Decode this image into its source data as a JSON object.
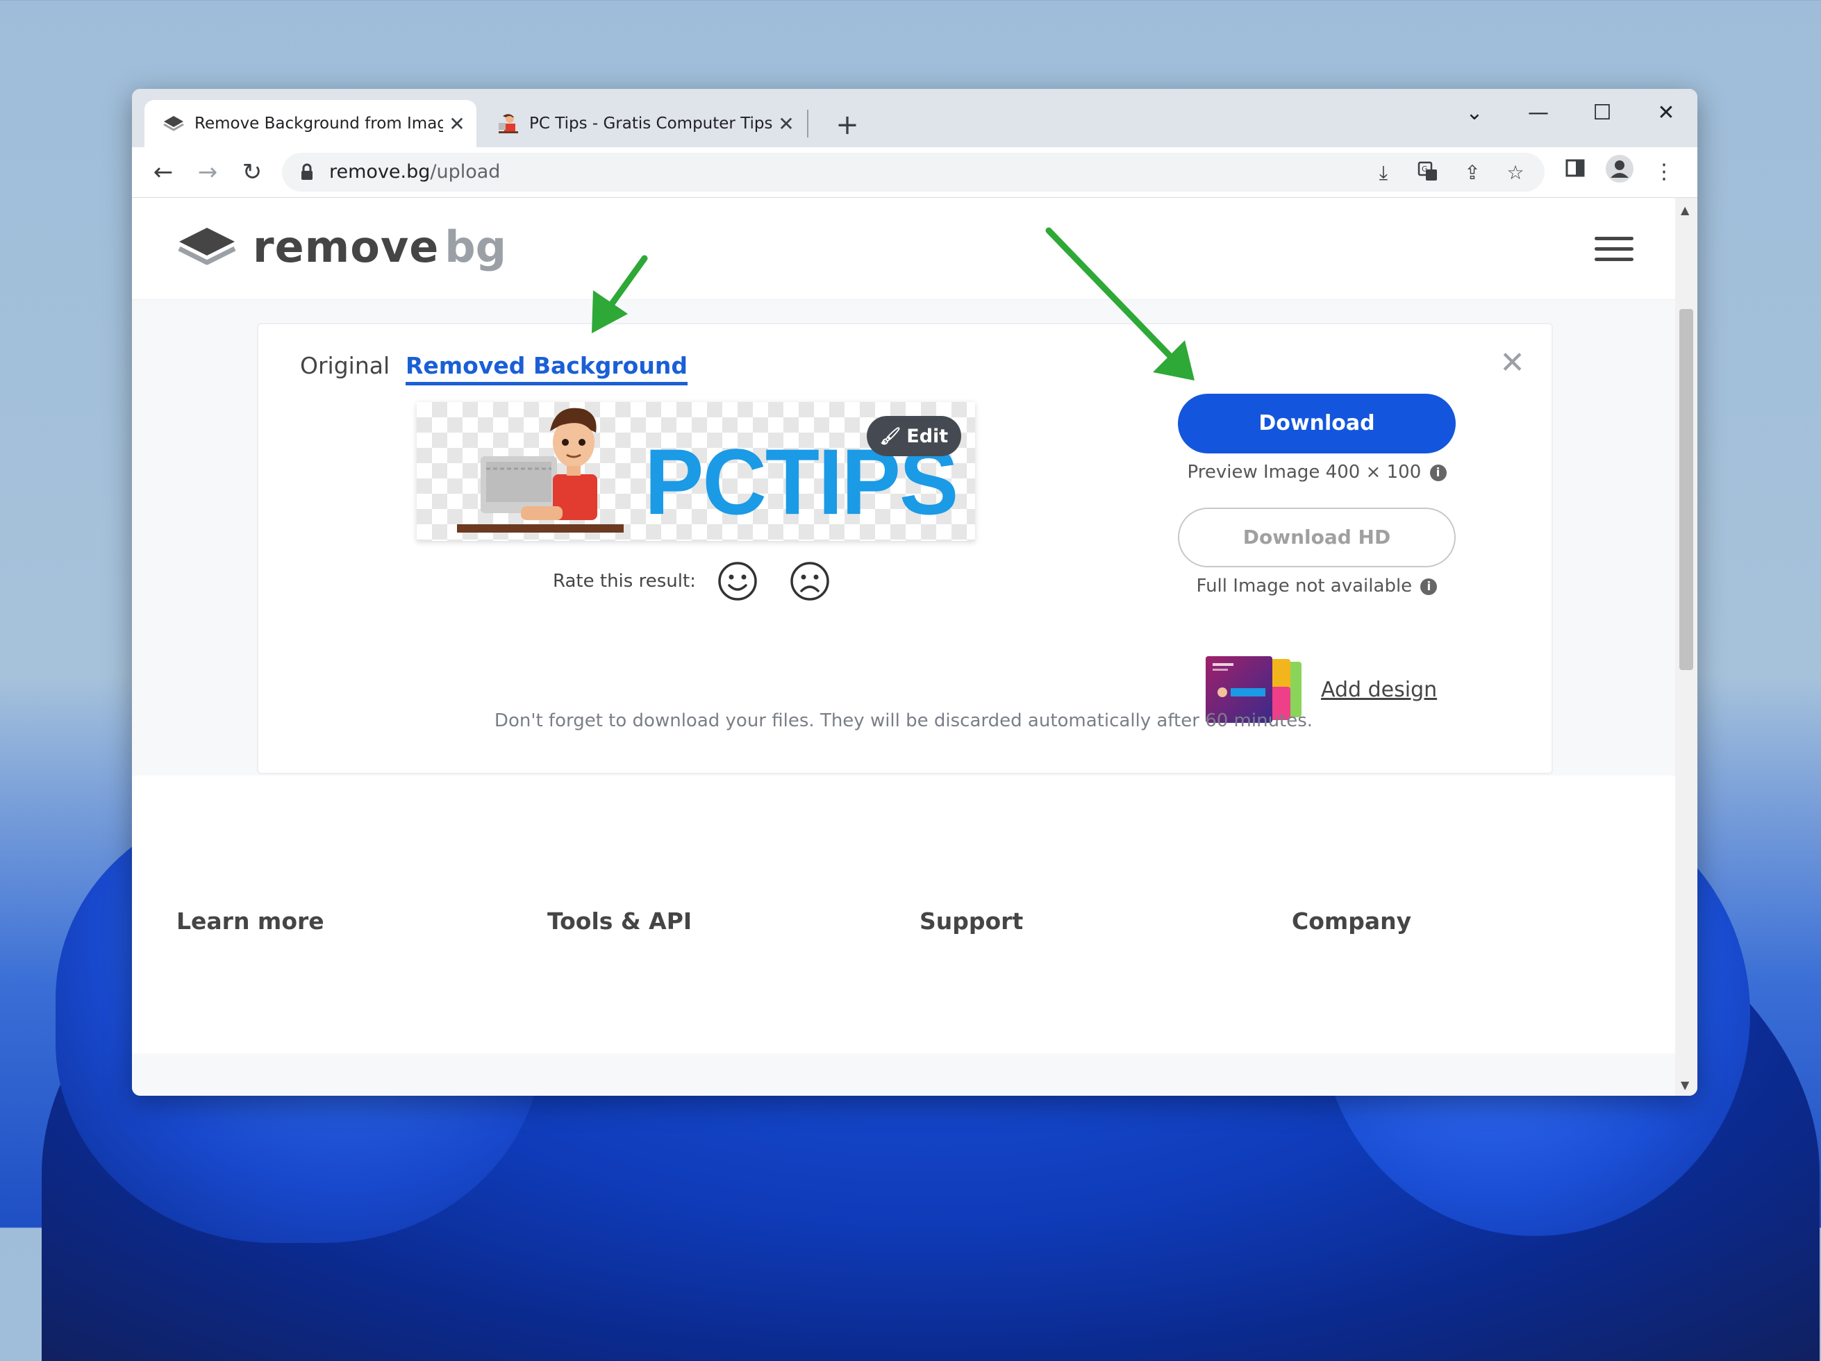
{
  "browser": {
    "tabs": [
      {
        "title": "Remove Background from Image",
        "active": true
      },
      {
        "title": "PC Tips - Gratis Computer Tips, i",
        "active": false
      }
    ],
    "new_tab_symbol": "+",
    "url_host": "remove.bg",
    "url_path": "/upload"
  },
  "site": {
    "logo_word1": "remove",
    "logo_word2": "bg"
  },
  "card": {
    "tab_original": "Original",
    "tab_removed": "Removed Background",
    "preview_text": "PCTIPS",
    "edit_label": "Edit",
    "rate_label": "Rate this result:",
    "download_label": "Download",
    "preview_info": "Preview Image 400 × 100",
    "download_hd_label": "Download HD",
    "full_info": "Full Image not available",
    "add_design_label": "Add design"
  },
  "discard_note": "Don't forget to download your files. They will be discarded automatically after 60 minutes.",
  "footer": {
    "columns": [
      "Learn more",
      "Tools & API",
      "Support",
      "Company"
    ]
  },
  "colors": {
    "accent": "#1356dd",
    "tab_active": "#1a5fd6",
    "annotation_arrow": "#2ea836",
    "pc_tips_text": "#1b9ae6"
  }
}
